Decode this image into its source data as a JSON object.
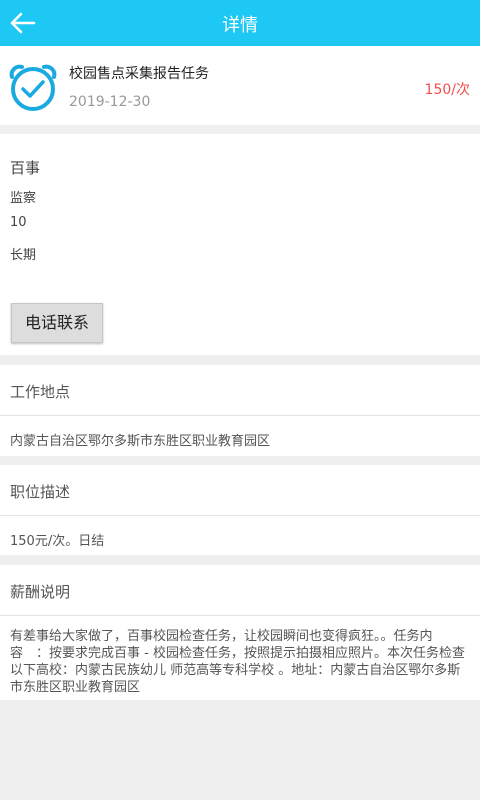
{
  "header": {
    "title": "详情",
    "back_icon": "arrow-left-icon"
  },
  "task": {
    "icon": "alarm-clock-check-icon",
    "title": "校园售点采集报告任务",
    "date": "2019-12-30",
    "price": "150/次"
  },
  "info": {
    "company": "百事",
    "type": "监察",
    "count": "10",
    "period": "长期",
    "call_button": "电话联系"
  },
  "location": {
    "title": "工作地点",
    "address": "内蒙古自治区鄂尔多斯市东胜区职业教育园区"
  },
  "description": {
    "title": "职位描述",
    "text": "150元/次。日结"
  },
  "salary": {
    "title": "薪酬说明",
    "text": "有差事给大家做了，百事校园检查任务，让校园瞬间也变得疯狂。。任务内容　：按要求完成百事 - 校园检查任务，按照提示拍摄相应照片。本次任务检查以下高校：内蒙古民族幼儿 师范高等专科学校 。地址：内蒙古自治区鄂尔多斯市东胜区职业教育园区"
  },
  "colors": {
    "header": "#1ec8f5",
    "price": "#ef4e4e",
    "background": "#efefef"
  }
}
